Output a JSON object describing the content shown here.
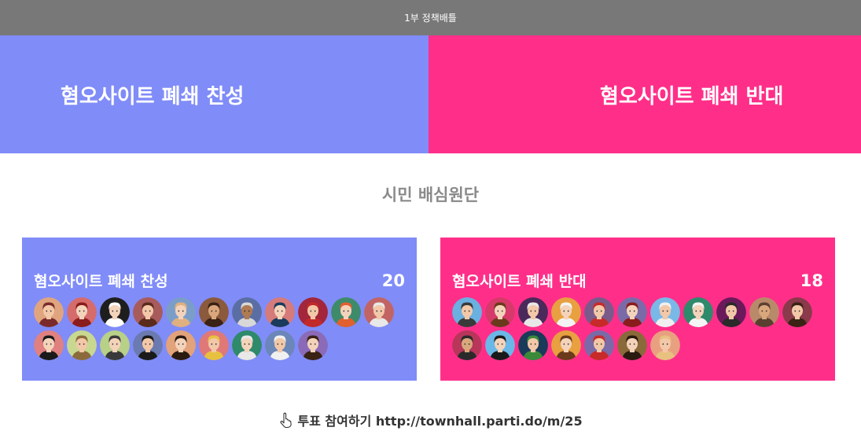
{
  "header": {
    "title": "1부 정책배틀"
  },
  "battle": {
    "pro_label": "혐오사이트 폐쇄 찬성",
    "con_label": "혐오사이트 폐쇄 반대"
  },
  "jury": {
    "title": "시민 배심원단",
    "pro": {
      "label": "혐오사이트 폐쇄 찬성",
      "count": "20",
      "avatars": [
        {
          "bg": "#e0a57f",
          "hair": "#7a2a2a",
          "skin": "#f2c8a8"
        },
        {
          "bg": "#d66b6b",
          "hair": "#8b1c1c",
          "skin": "#f4d3bb"
        },
        {
          "bg": "#1e1e1e",
          "hair": "#ffffff",
          "skin": "#f4d3bb"
        },
        {
          "bg": "#a85b5b",
          "hair": "#5a2b1c",
          "skin": "#f2c8a8"
        },
        {
          "bg": "#7b9ec9",
          "hair": "#e0b080",
          "skin": "#f4d3bb"
        },
        {
          "bg": "#8b5a3c",
          "hair": "#3a2214",
          "skin": "#d9a77c"
        },
        {
          "bg": "#5b6ea3",
          "hair": "#d8d8d8",
          "skin": "#b07a52"
        },
        {
          "bg": "#d67b7b",
          "hair": "#1a3b5c",
          "skin": "#f4d3bb"
        },
        {
          "bg": "#a3263a",
          "hair": "#c22a2a",
          "skin": "#f2c8a8"
        },
        {
          "bg": "#3e8b6b",
          "hair": "#e06030",
          "skin": "#f4d3bb"
        },
        {
          "bg": "#c26464",
          "hair": "#e8e8e8",
          "skin": "#f2c8a8"
        },
        {
          "bg": "#e08080",
          "hair": "#1a1a1a",
          "skin": "#f4d3bb"
        },
        {
          "bg": "#c8d890",
          "hair": "#8b6b3c",
          "skin": "#f2c8a8"
        },
        {
          "bg": "#b8d088",
          "hair": "#3a3a3a",
          "skin": "#f4d3bb"
        },
        {
          "bg": "#6b7ab0",
          "hair": "#1a1a1a",
          "skin": "#f2c8a8"
        },
        {
          "bg": "#e2a27a",
          "hair": "#2a1a10",
          "skin": "#f4d3bb"
        },
        {
          "bg": "#e07878",
          "hair": "#e8c040",
          "skin": "#f2c8a8"
        },
        {
          "bg": "#2e8a6a",
          "hair": "#e8e8e8",
          "skin": "#f4d3bb"
        },
        {
          "bg": "#6b86b8",
          "hair": "#f0f0f0",
          "skin": "#f2c8a8"
        },
        {
          "bg": "#8b6bb8",
          "hair": "#3a2214",
          "skin": "#f4d3bb"
        }
      ]
    },
    "con": {
      "label": "혐오사이트 폐쇄 반대",
      "count": "18",
      "avatars": [
        {
          "bg": "#6ab0e0",
          "hair": "#3a3a3a",
          "skin": "#f2c8a8"
        },
        {
          "bg": "#d63a6a",
          "hair": "#6b3a1c",
          "skin": "#f4d3bb"
        },
        {
          "bg": "#4a2a5a",
          "hair": "#e8e8e8",
          "skin": "#f2c8a8"
        },
        {
          "bg": "#e8a040",
          "hair": "#f4f4f4",
          "skin": "#f4d3bb"
        },
        {
          "bg": "#7a5a8a",
          "hair": "#c82a2a",
          "skin": "#f2c8a8"
        },
        {
          "bg": "#7a6aa8",
          "hair": "#8b1c1c",
          "skin": "#f4d3bb"
        },
        {
          "bg": "#7ab8e8",
          "hair": "#f0f0f0",
          "skin": "#f2c8a8"
        },
        {
          "bg": "#2e8a6a",
          "hair": "#f4f4f4",
          "skin": "#f4d3bb"
        },
        {
          "bg": "#6a1a5a",
          "hair": "#2a2a2a",
          "skin": "#f2c8a8"
        },
        {
          "bg": "#b88a6a",
          "hair": "#5a4030",
          "skin": "#d9a77c"
        },
        {
          "bg": "#8a3a4a",
          "hair": "#3a2214",
          "skin": "#f2c8a8"
        },
        {
          "bg": "#b8365a",
          "hair": "#2a2a2a",
          "skin": "#d9a77c"
        },
        {
          "bg": "#6ab8e8",
          "hair": "#1a1a1a",
          "skin": "#f4d3bb"
        },
        {
          "bg": "#1a3a5a",
          "hair": "#3a8a3a",
          "skin": "#f2c8a8"
        },
        {
          "bg": "#e8a040",
          "hair": "#6b3a1c",
          "skin": "#f4d3bb"
        },
        {
          "bg": "#7a6aa8",
          "hair": "#c82a2a",
          "skin": "#f2c8a8"
        },
        {
          "bg": "#8a6a3a",
          "hair": "#2a1a10",
          "skin": "#f4d3bb"
        },
        {
          "bg": "#e8a080",
          "hair": "#e8c080",
          "skin": "#f2c8a8"
        }
      ]
    }
  },
  "footer": {
    "icon": "pointing-hand-icon",
    "text": "투표 참여하기 http://townhall.parti.do/m/25"
  },
  "colors": {
    "pro": "#808cf8",
    "con": "#ff2f89",
    "topbar": "#787878"
  }
}
